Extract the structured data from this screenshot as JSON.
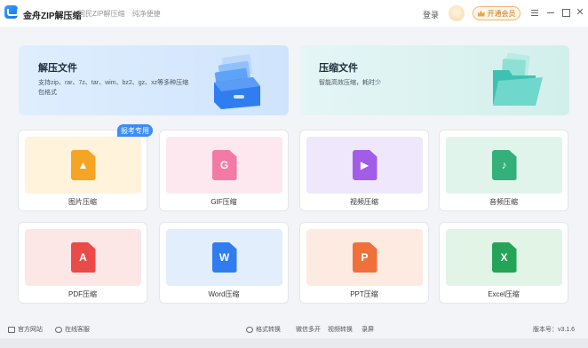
{
  "titlebar": {
    "app_name": "金舟ZIP解压缩",
    "slogan": [
      "国民ZIP解压缩",
      "纯净便捷"
    ],
    "login": "登录",
    "vip": "开通会员"
  },
  "banners": [
    {
      "title": "解压文件",
      "desc": "支持zip、rar、7z、tar、wim、bz2、gz、xz等多种压缩包格式"
    },
    {
      "title": "压缩文件",
      "desc": "智能高效压缩，耗时少"
    }
  ],
  "tag": "报考专用",
  "cards": [
    {
      "label": "图片压缩",
      "glyph": "▲",
      "icon": "image-file-icon",
      "bg": "#fff3dc",
      "color": "#f4a524"
    },
    {
      "label": "GIF压缩",
      "glyph": "G",
      "icon": "gif-file-icon",
      "bg": "#fde8f0",
      "color": "#f37aa5"
    },
    {
      "label": "视频压缩",
      "glyph": "▶",
      "icon": "video-file-icon",
      "bg": "#efe7fb",
      "color": "#a25de8"
    },
    {
      "label": "音频压缩",
      "glyph": "♪",
      "icon": "audio-file-icon",
      "bg": "#e1f4ec",
      "color": "#34b07b"
    },
    {
      "label": "PDF压缩",
      "glyph": "A",
      "icon": "pdf-file-icon",
      "bg": "#fde6e6",
      "color": "#ea4a48"
    },
    {
      "label": "Word压缩",
      "glyph": "W",
      "icon": "word-file-icon",
      "bg": "#e3eefc",
      "color": "#2f7df0"
    },
    {
      "label": "PPT压缩",
      "glyph": "P",
      "icon": "ppt-file-icon",
      "bg": "#fdebe2",
      "color": "#f0703a"
    },
    {
      "label": "Excel压缩",
      "glyph": "X",
      "icon": "excel-file-icon",
      "bg": "#e1f4e6",
      "color": "#25a457"
    }
  ],
  "footer": {
    "website": "官方网站",
    "support": "在线客服",
    "links": [
      "格式转换",
      "微信多开",
      "视频转换",
      "录屏"
    ],
    "version": "版本号：v3.1.6"
  }
}
